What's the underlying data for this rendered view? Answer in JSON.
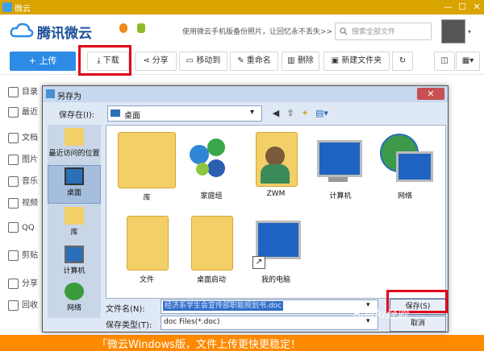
{
  "window": {
    "title": "微云",
    "minimize": "—",
    "maximize": "☐",
    "close": "✕"
  },
  "header": {
    "logo_text": "腾讯微云",
    "ad_text": "使用微云手机版备份照片，让回忆永不丢失>>",
    "search_placeholder": "搜索全部文件"
  },
  "toolbar": {
    "upload_label": "+ 上传",
    "download_label": "下载",
    "share_label": "分享",
    "move_label": "移动到",
    "rename_label": "重命名",
    "delete_label": "删除",
    "new_folder_label": "新建文件夹"
  },
  "sidebar": {
    "items": [
      {
        "label": "目录"
      },
      {
        "label": "最近"
      },
      {
        "label": "文档"
      },
      {
        "label": "图片"
      },
      {
        "label": "音乐"
      },
      {
        "label": "视频"
      },
      {
        "label": "QQ"
      },
      {
        "label": "剪贴"
      },
      {
        "label": "分享"
      },
      {
        "label": "回收"
      }
    ]
  },
  "dialog": {
    "title": "另存为",
    "location_label": "保存在(I):",
    "location_value": "桌面",
    "places": [
      {
        "label": "最近访问的位置"
      },
      {
        "label": "桌面"
      },
      {
        "label": "库"
      },
      {
        "label": "计算机"
      },
      {
        "label": "网络"
      }
    ],
    "files": [
      {
        "label": "库"
      },
      {
        "label": "家庭组"
      },
      {
        "label": "ZWM"
      },
      {
        "label": "计算机"
      },
      {
        "label": "网络"
      },
      {
        "label": "文件"
      },
      {
        "label": "桌面启动"
      },
      {
        "label": "我的电脑"
      }
    ],
    "filename_label": "文件名(N):",
    "filename_value": "经济系学生会宣传部职能规划书.doc",
    "filetype_label": "保存类型(T):",
    "filetype_value": "doc Files(*.doc)",
    "save_label": "保存(S)",
    "cancel_label": "取消"
  },
  "bottom_banner": {
    "text": "「微云Windows版，文件上传更快更稳定！"
  },
  "watermark": {
    "text": "Baidu经验"
  },
  "colors": {
    "accent": "#2d8be6",
    "highlight": "#e0001a",
    "titlebar": "#d9a300",
    "banner": "#ff8a00"
  }
}
